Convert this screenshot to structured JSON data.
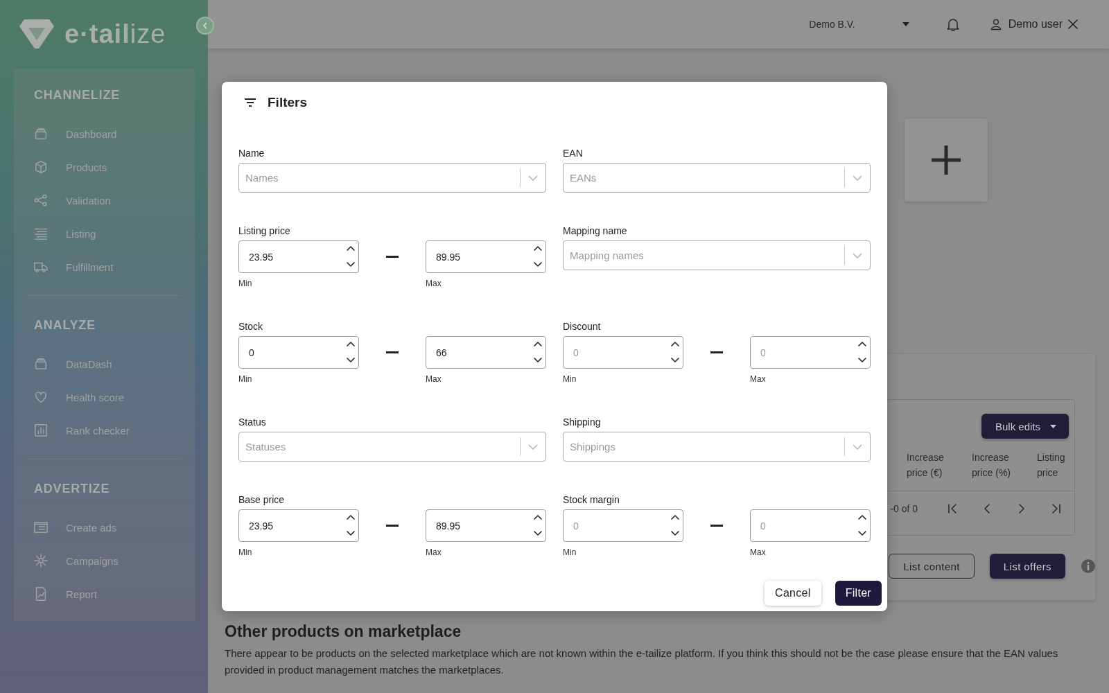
{
  "sidebar": {
    "logo": "**e·tail**ize",
    "sections": [
      {
        "title": "CHANNELIZE",
        "items": [
          {
            "label": "Dashboard"
          },
          {
            "label": "Products"
          },
          {
            "label": "Validation"
          },
          {
            "label": "Listing"
          },
          {
            "label": "Fulfillment"
          }
        ]
      },
      {
        "title": "ANALYZE",
        "items": [
          {
            "label": "DataDash"
          },
          {
            "label": "Health score"
          },
          {
            "label": "Rank checker"
          }
        ]
      },
      {
        "title": "ADVERTIZE",
        "items": [
          {
            "label": "Create ads"
          },
          {
            "label": "Campaigns"
          },
          {
            "label": "Report"
          }
        ]
      }
    ]
  },
  "header": {
    "company": "Demo B.V.",
    "user": "Demo user"
  },
  "page": {
    "table": {
      "bulk_button": "Bulk edits",
      "columns": [
        "Increase price (€)",
        "Increase price (%)",
        "Listing price"
      ],
      "pagination": "-0 of 0"
    },
    "buttons": [
      {
        "label": "List content",
        "kind": "outline"
      },
      {
        "label": "List offers",
        "kind": "primary"
      }
    ],
    "other": {
      "heading": "Other products on marketplace",
      "text": "There appear to be products on the selected marketplace which are not known within the e-tailize platform. If you think this should not be the case please ensure that the EAN values provided in product management matches the marketplaces."
    }
  },
  "modal": {
    "title": "Filters",
    "fields": [
      {
        "kind": "select",
        "label": "Name",
        "placeholder": "Names"
      },
      {
        "kind": "select",
        "label": "EAN",
        "placeholder": "EANs"
      },
      {
        "kind": "range",
        "label": "Listing price",
        "min": {
          "value": "23.95"
        },
        "max": {
          "value": "89.95"
        },
        "min_label": "Min",
        "max_label": "Max"
      },
      {
        "kind": "select",
        "label": "Mapping name",
        "placeholder": "Mapping names"
      },
      {
        "kind": "range",
        "label": "Stock",
        "min": {
          "value": "0"
        },
        "max": {
          "value": "66"
        },
        "min_label": "Min",
        "max_label": "Max"
      },
      {
        "kind": "range",
        "label": "Discount",
        "min": {
          "placeholder": "0"
        },
        "max": {
          "placeholder": "0"
        },
        "min_label": "Min",
        "max_label": "Max"
      },
      {
        "kind": "select",
        "label": "Status",
        "placeholder": "Statuses"
      },
      {
        "kind": "select",
        "label": "Shipping",
        "placeholder": "Shippings"
      },
      {
        "kind": "range",
        "label": "Base price",
        "min": {
          "value": "23.95"
        },
        "max": {
          "value": "89.95"
        },
        "min_label": "Min",
        "max_label": "Max"
      },
      {
        "kind": "range",
        "label": "Stock margin",
        "min": {
          "placeholder": "0"
        },
        "max": {
          "placeholder": "0"
        },
        "min_label": "Min",
        "max_label": "Max"
      }
    ],
    "buttons": [
      {
        "label": "Cancel",
        "kind": "secondary"
      },
      {
        "label": "Filter",
        "kind": "primary"
      }
    ]
  }
}
